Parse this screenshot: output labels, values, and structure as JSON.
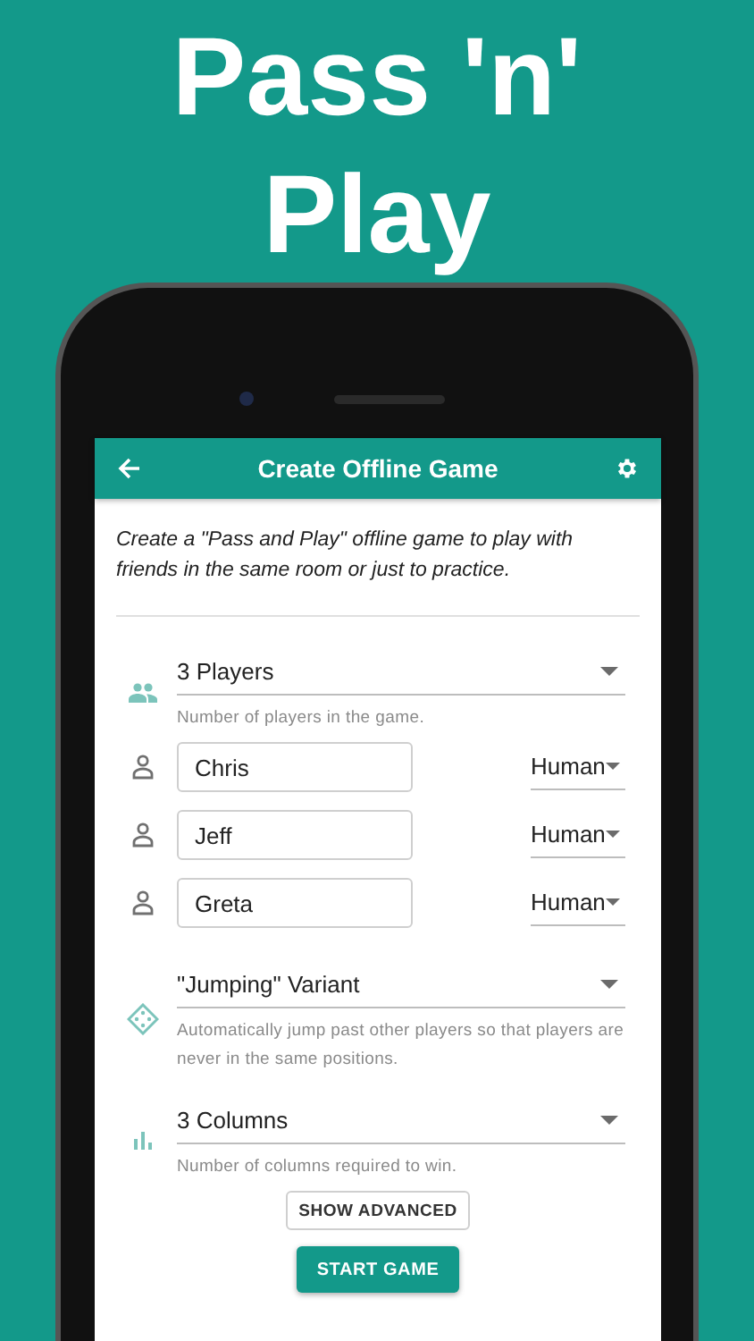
{
  "headline": "Pass 'n' Play",
  "app_bar": {
    "title": "Create Offline Game"
  },
  "intro": "Create a \"Pass and Play\" offline game to play with friends in the same room or just to practice.",
  "players_select": {
    "value": "3 Players",
    "helper": "Number of players in the game."
  },
  "players": [
    {
      "name": "Chris",
      "type": "Human"
    },
    {
      "name": "Jeff",
      "type": "Human"
    },
    {
      "name": "Greta",
      "type": "Human"
    }
  ],
  "variant_select": {
    "value": "\"Jumping\" Variant",
    "helper": "Automatically jump past other players so that players are never in the same positions."
  },
  "columns_select": {
    "value": "3 Columns",
    "helper": "Number of columns required to win."
  },
  "buttons": [
    {
      "label": "SHOW ADVANCED",
      "kind": "outlined"
    },
    {
      "label": "START GAME",
      "kind": "filled"
    }
  ]
}
